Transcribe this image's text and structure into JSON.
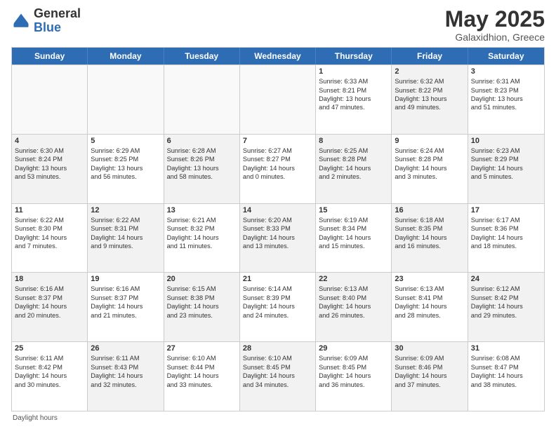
{
  "header": {
    "logo_general": "General",
    "logo_blue": "Blue",
    "month_title": "May 2025",
    "location": "Galaxidhion, Greece"
  },
  "calendar": {
    "days_of_week": [
      "Sunday",
      "Monday",
      "Tuesday",
      "Wednesday",
      "Thursday",
      "Friday",
      "Saturday"
    ],
    "rows": [
      [
        {
          "day": "",
          "lines": [],
          "shaded": false,
          "empty": true
        },
        {
          "day": "",
          "lines": [],
          "shaded": false,
          "empty": true
        },
        {
          "day": "",
          "lines": [],
          "shaded": false,
          "empty": true
        },
        {
          "day": "",
          "lines": [],
          "shaded": false,
          "empty": true
        },
        {
          "day": "1",
          "lines": [
            "Sunrise: 6:33 AM",
            "Sunset: 8:21 PM",
            "Daylight: 13 hours",
            "and 47 minutes."
          ],
          "shaded": false,
          "empty": false
        },
        {
          "day": "2",
          "lines": [
            "Sunrise: 6:32 AM",
            "Sunset: 8:22 PM",
            "Daylight: 13 hours",
            "and 49 minutes."
          ],
          "shaded": true,
          "empty": false
        },
        {
          "day": "3",
          "lines": [
            "Sunrise: 6:31 AM",
            "Sunset: 8:23 PM",
            "Daylight: 13 hours",
            "and 51 minutes."
          ],
          "shaded": false,
          "empty": false
        }
      ],
      [
        {
          "day": "4",
          "lines": [
            "Sunrise: 6:30 AM",
            "Sunset: 8:24 PM",
            "Daylight: 13 hours",
            "and 53 minutes."
          ],
          "shaded": true,
          "empty": false
        },
        {
          "day": "5",
          "lines": [
            "Sunrise: 6:29 AM",
            "Sunset: 8:25 PM",
            "Daylight: 13 hours",
            "and 56 minutes."
          ],
          "shaded": false,
          "empty": false
        },
        {
          "day": "6",
          "lines": [
            "Sunrise: 6:28 AM",
            "Sunset: 8:26 PM",
            "Daylight: 13 hours",
            "and 58 minutes."
          ],
          "shaded": true,
          "empty": false
        },
        {
          "day": "7",
          "lines": [
            "Sunrise: 6:27 AM",
            "Sunset: 8:27 PM",
            "Daylight: 14 hours",
            "and 0 minutes."
          ],
          "shaded": false,
          "empty": false
        },
        {
          "day": "8",
          "lines": [
            "Sunrise: 6:25 AM",
            "Sunset: 8:28 PM",
            "Daylight: 14 hours",
            "and 2 minutes."
          ],
          "shaded": true,
          "empty": false
        },
        {
          "day": "9",
          "lines": [
            "Sunrise: 6:24 AM",
            "Sunset: 8:28 PM",
            "Daylight: 14 hours",
            "and 3 minutes."
          ],
          "shaded": false,
          "empty": false
        },
        {
          "day": "10",
          "lines": [
            "Sunrise: 6:23 AM",
            "Sunset: 8:29 PM",
            "Daylight: 14 hours",
            "and 5 minutes."
          ],
          "shaded": true,
          "empty": false
        }
      ],
      [
        {
          "day": "11",
          "lines": [
            "Sunrise: 6:22 AM",
            "Sunset: 8:30 PM",
            "Daylight: 14 hours",
            "and 7 minutes."
          ],
          "shaded": false,
          "empty": false
        },
        {
          "day": "12",
          "lines": [
            "Sunrise: 6:22 AM",
            "Sunset: 8:31 PM",
            "Daylight: 14 hours",
            "and 9 minutes."
          ],
          "shaded": true,
          "empty": false
        },
        {
          "day": "13",
          "lines": [
            "Sunrise: 6:21 AM",
            "Sunset: 8:32 PM",
            "Daylight: 14 hours",
            "and 11 minutes."
          ],
          "shaded": false,
          "empty": false
        },
        {
          "day": "14",
          "lines": [
            "Sunrise: 6:20 AM",
            "Sunset: 8:33 PM",
            "Daylight: 14 hours",
            "and 13 minutes."
          ],
          "shaded": true,
          "empty": false
        },
        {
          "day": "15",
          "lines": [
            "Sunrise: 6:19 AM",
            "Sunset: 8:34 PM",
            "Daylight: 14 hours",
            "and 15 minutes."
          ],
          "shaded": false,
          "empty": false
        },
        {
          "day": "16",
          "lines": [
            "Sunrise: 6:18 AM",
            "Sunset: 8:35 PM",
            "Daylight: 14 hours",
            "and 16 minutes."
          ],
          "shaded": true,
          "empty": false
        },
        {
          "day": "17",
          "lines": [
            "Sunrise: 6:17 AM",
            "Sunset: 8:36 PM",
            "Daylight: 14 hours",
            "and 18 minutes."
          ],
          "shaded": false,
          "empty": false
        }
      ],
      [
        {
          "day": "18",
          "lines": [
            "Sunrise: 6:16 AM",
            "Sunset: 8:37 PM",
            "Daylight: 14 hours",
            "and 20 minutes."
          ],
          "shaded": true,
          "empty": false
        },
        {
          "day": "19",
          "lines": [
            "Sunrise: 6:16 AM",
            "Sunset: 8:37 PM",
            "Daylight: 14 hours",
            "and 21 minutes."
          ],
          "shaded": false,
          "empty": false
        },
        {
          "day": "20",
          "lines": [
            "Sunrise: 6:15 AM",
            "Sunset: 8:38 PM",
            "Daylight: 14 hours",
            "and 23 minutes."
          ],
          "shaded": true,
          "empty": false
        },
        {
          "day": "21",
          "lines": [
            "Sunrise: 6:14 AM",
            "Sunset: 8:39 PM",
            "Daylight: 14 hours",
            "and 24 minutes."
          ],
          "shaded": false,
          "empty": false
        },
        {
          "day": "22",
          "lines": [
            "Sunrise: 6:13 AM",
            "Sunset: 8:40 PM",
            "Daylight: 14 hours",
            "and 26 minutes."
          ],
          "shaded": true,
          "empty": false
        },
        {
          "day": "23",
          "lines": [
            "Sunrise: 6:13 AM",
            "Sunset: 8:41 PM",
            "Daylight: 14 hours",
            "and 28 minutes."
          ],
          "shaded": false,
          "empty": false
        },
        {
          "day": "24",
          "lines": [
            "Sunrise: 6:12 AM",
            "Sunset: 8:42 PM",
            "Daylight: 14 hours",
            "and 29 minutes."
          ],
          "shaded": true,
          "empty": false
        }
      ],
      [
        {
          "day": "25",
          "lines": [
            "Sunrise: 6:11 AM",
            "Sunset: 8:42 PM",
            "Daylight: 14 hours",
            "and 30 minutes."
          ],
          "shaded": false,
          "empty": false
        },
        {
          "day": "26",
          "lines": [
            "Sunrise: 6:11 AM",
            "Sunset: 8:43 PM",
            "Daylight: 14 hours",
            "and 32 minutes."
          ],
          "shaded": true,
          "empty": false
        },
        {
          "day": "27",
          "lines": [
            "Sunrise: 6:10 AM",
            "Sunset: 8:44 PM",
            "Daylight: 14 hours",
            "and 33 minutes."
          ],
          "shaded": false,
          "empty": false
        },
        {
          "day": "28",
          "lines": [
            "Sunrise: 6:10 AM",
            "Sunset: 8:45 PM",
            "Daylight: 14 hours",
            "and 34 minutes."
          ],
          "shaded": true,
          "empty": false
        },
        {
          "day": "29",
          "lines": [
            "Sunrise: 6:09 AM",
            "Sunset: 8:45 PM",
            "Daylight: 14 hours",
            "and 36 minutes."
          ],
          "shaded": false,
          "empty": false
        },
        {
          "day": "30",
          "lines": [
            "Sunrise: 6:09 AM",
            "Sunset: 8:46 PM",
            "Daylight: 14 hours",
            "and 37 minutes."
          ],
          "shaded": true,
          "empty": false
        },
        {
          "day": "31",
          "lines": [
            "Sunrise: 6:08 AM",
            "Sunset: 8:47 PM",
            "Daylight: 14 hours",
            "and 38 minutes."
          ],
          "shaded": false,
          "empty": false
        }
      ]
    ]
  },
  "footer": {
    "note": "Daylight hours"
  }
}
